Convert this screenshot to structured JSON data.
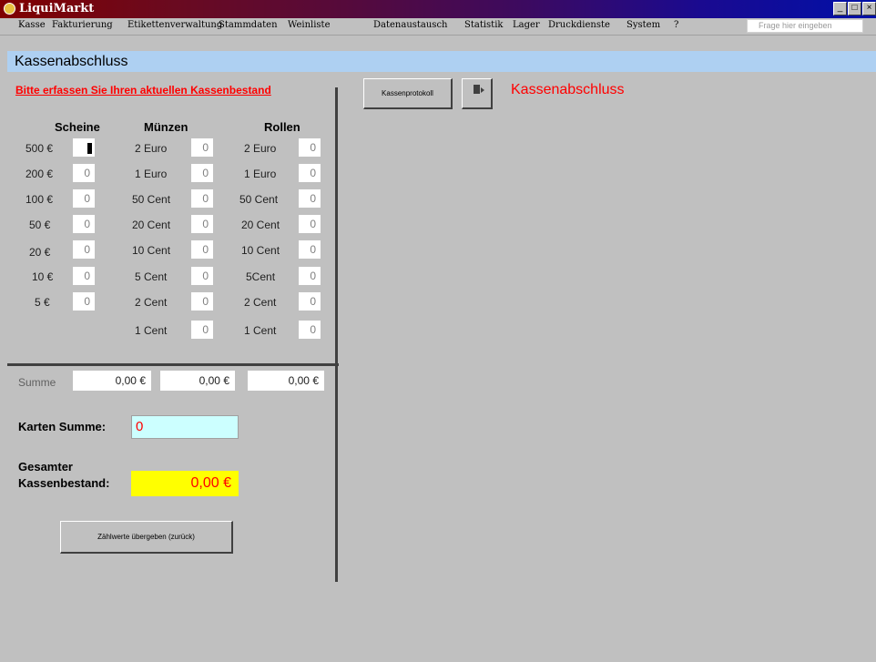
{
  "window": {
    "title": "LiquiMarkt",
    "buttons": [
      "_",
      "□",
      "×"
    ]
  },
  "menu": {
    "items": [
      "Kasse",
      "Fakturierung",
      "Etikettenverwaltung",
      "Stammdaten",
      "Weinliste",
      "Datenaustausch",
      "Statistik",
      "Lager",
      "Druckdienste",
      "System",
      "?"
    ],
    "ask_placeholder": "Frage hier eingeben"
  },
  "form": {
    "title": "Kassenabschluss",
    "instruction": "Bitte erfassen Sie Ihren aktuellen Kassenbestand",
    "columns": {
      "scheine": "Scheine",
      "muenzen": "Münzen",
      "rollen": "Rollen"
    },
    "scheine": [
      {
        "label": "500 €",
        "value": ""
      },
      {
        "label": "200 €",
        "value": "0"
      },
      {
        "label": "100 €",
        "value": "0"
      },
      {
        "label": "50 €",
        "value": "0"
      },
      {
        "label": "20 €",
        "value": "0"
      },
      {
        "label": "10 €",
        "value": "0"
      },
      {
        "label": "5 €",
        "value": "0"
      }
    ],
    "muenzen": [
      {
        "label": "2 Euro",
        "value": "0"
      },
      {
        "label": "1 Euro",
        "value": "0"
      },
      {
        "label": "50 Cent",
        "value": "0"
      },
      {
        "label": "20 Cent",
        "value": "0"
      },
      {
        "label": "10 Cent",
        "value": "0"
      },
      {
        "label": "5 Cent",
        "value": "0"
      },
      {
        "label": "2 Cent",
        "value": "0"
      },
      {
        "label": "1 Cent",
        "value": "0"
      }
    ],
    "rollen": [
      {
        "label": "2 Euro",
        "value": "0"
      },
      {
        "label": "1 Euro",
        "value": "0"
      },
      {
        "label": "50 Cent",
        "value": "0"
      },
      {
        "label": "20 Cent",
        "value": "0"
      },
      {
        "label": "10 Cent",
        "value": "0"
      },
      {
        "label": "5Cent",
        "value": "0"
      },
      {
        "label": "2 Cent",
        "value": "0"
      },
      {
        "label": "1 Cent",
        "value": "0"
      }
    ],
    "summe_label": "Summe",
    "summe_values": [
      "0,00 €",
      "0,00 €",
      "0,00 €"
    ],
    "karten_label": "Karten Summe:",
    "karten_value": "0",
    "gesamt_label_1": "Gesamter",
    "gesamt_label_2": "Kassenbestand:",
    "gesamt_value": "0,00 €",
    "submit_button": "Zählwerte übergeben (zurück)"
  },
  "right_panel": {
    "protokoll_button": "Kassenprotokoll",
    "exit_icon": "exit-door-icon",
    "title": "Kassenabschluss"
  },
  "colors": {
    "accent_red": "#ff0000",
    "header_blue": "#aed0f2",
    "karten_bg": "#ccffff",
    "gesamt_bg": "#ffff00"
  }
}
